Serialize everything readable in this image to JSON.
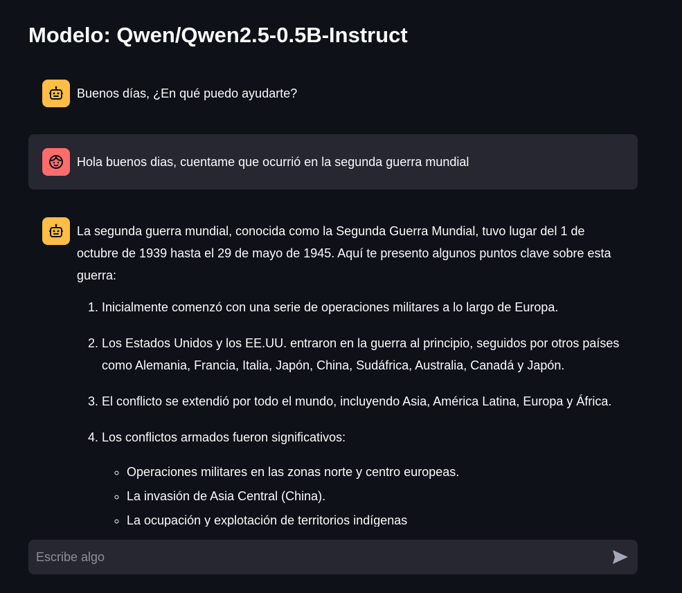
{
  "header": {
    "title": "Modelo: Qwen/Qwen2.5-0.5B-Instruct"
  },
  "messages": [
    {
      "role": "assistant",
      "avatar_icon": "robot-icon",
      "text": "Buenos días, ¿En qué puedo ayudarte?"
    },
    {
      "role": "user",
      "avatar_icon": "face-icon",
      "text": "Hola buenos dias, cuentame que ocurrió en la segunda guerra mundial"
    },
    {
      "role": "assistant",
      "avatar_icon": "robot-icon",
      "intro": "La segunda guerra mundial, conocida como la Segunda Guerra Mundial, tuvo lugar del 1 de octubre de 1939 hasta el 29 de mayo de 1945. Aquí te presento algunos puntos clave sobre esta guerra:",
      "points": [
        "Inicialmente comenzó con una serie de operaciones militares a lo largo de Europa.",
        "Los Estados Unidos y los EE.UU. entraron en la guerra al principio, seguidos por otros países como Alemania, Francia, Italia, Japón, China, Sudáfrica, Australia, Canadá y Japón.",
        "El conflicto se extendió por todo el mundo, incluyendo Asia, América Latina, Europa y África.",
        "Los conflictos armados fueron significativos:"
      ],
      "subpoints": [
        "Operaciones militares en las zonas norte y centro europeas.",
        "La invasión de Asia Central (China).",
        "La ocupación y explotación de territorios indígenas"
      ]
    }
  ],
  "chat_input": {
    "placeholder": "Escribe algo",
    "value": "",
    "send_icon": "send-icon"
  },
  "colors": {
    "background": "#0e1117",
    "user_bubble": "#262730",
    "assistant_avatar": "#ffbd45",
    "user_avatar": "#ff6c6c",
    "input_bg": "#262730",
    "text": "#fafafa"
  }
}
